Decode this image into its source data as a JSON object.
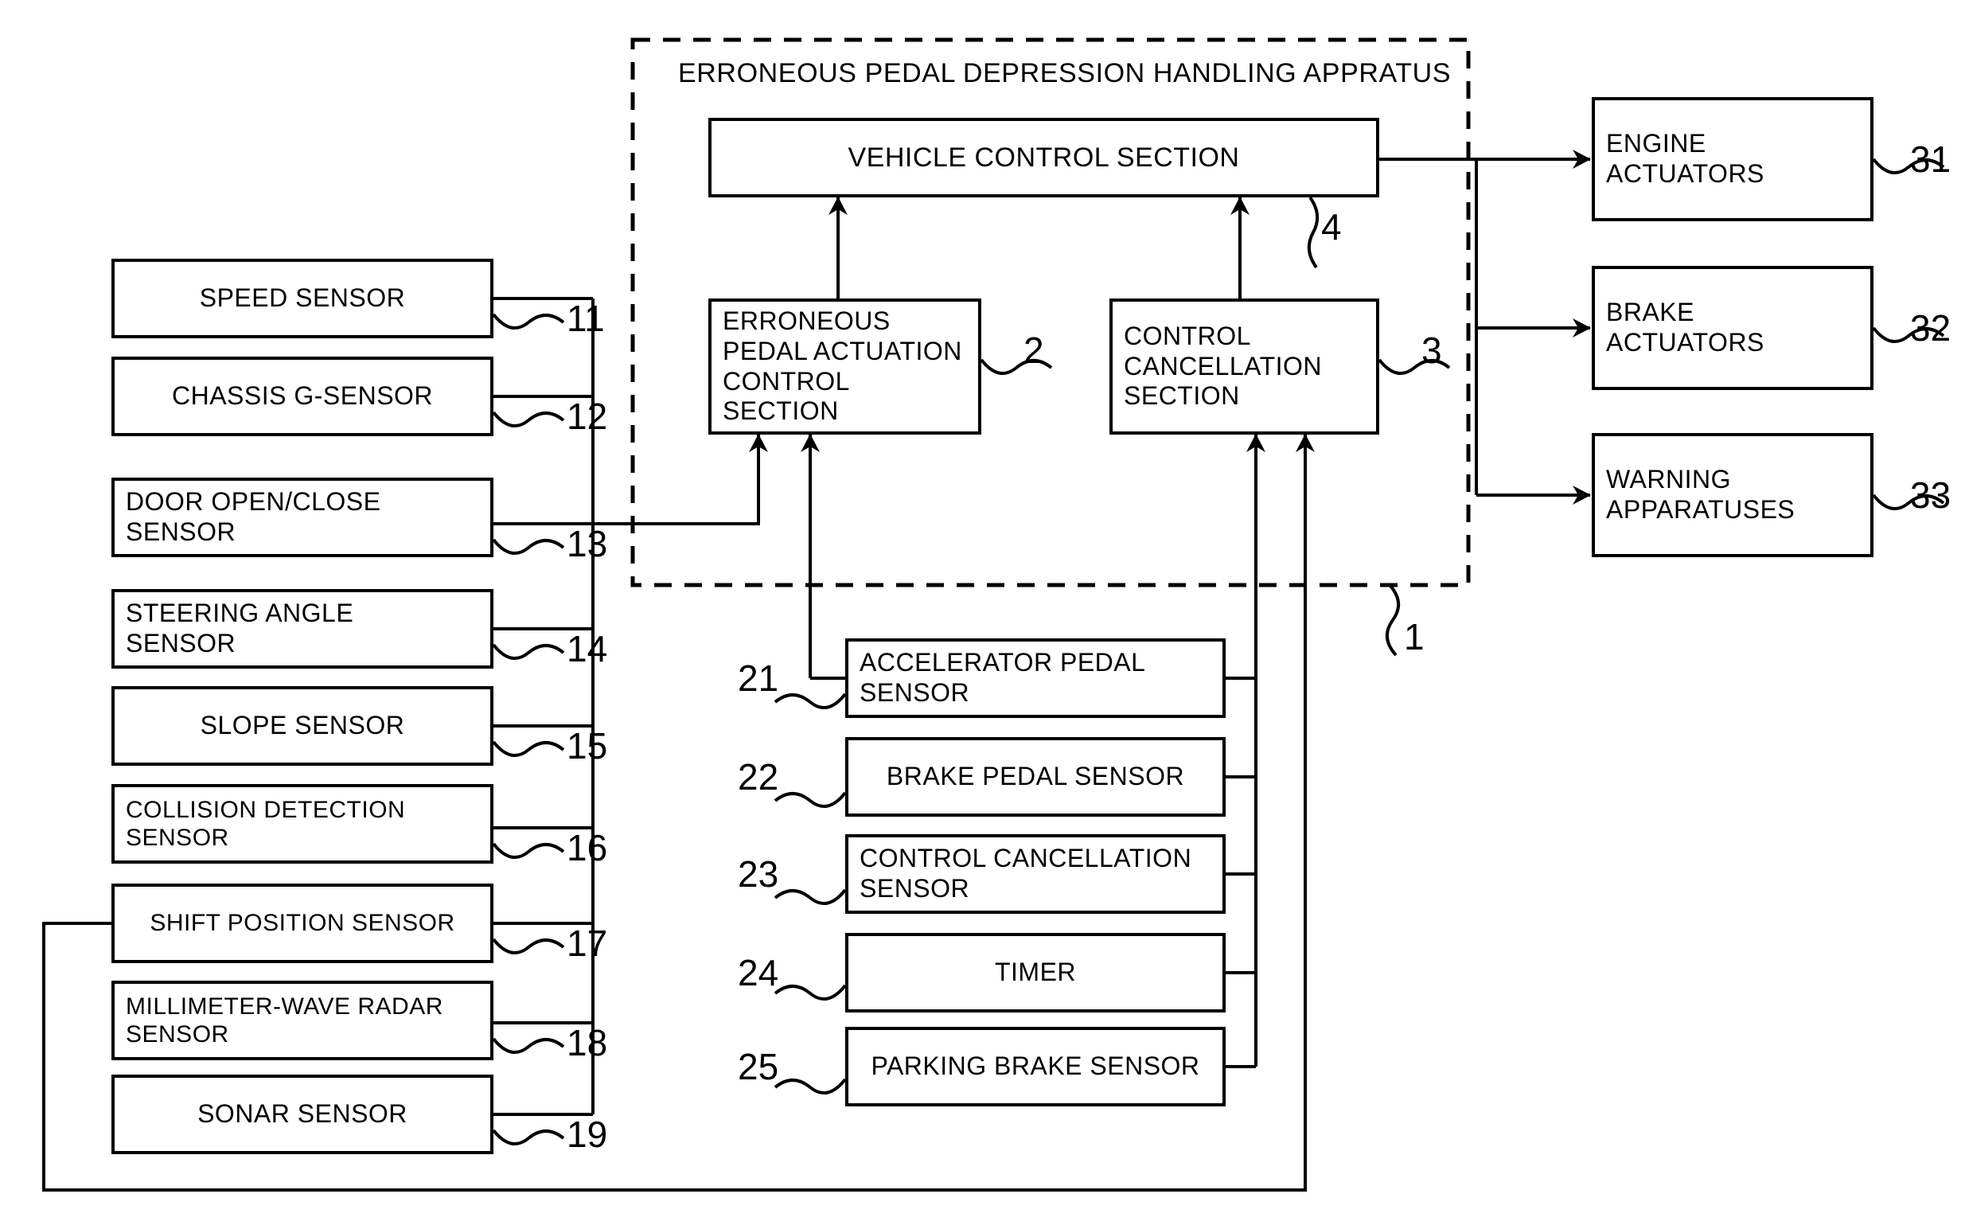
{
  "figure": {
    "enclosure_title": "ERRONEOUS PEDAL DEPRESSION HANDLING APPRATUS",
    "enclosure_ref": "1"
  },
  "apparatus": {
    "vehicle_control": {
      "label": "VEHICLE CONTROL SECTION",
      "ref": "4"
    },
    "erroneous_pedal": {
      "label": "ERRONEOUS\nPEDAL ACTUATION\nCONTROL SECTION",
      "ref": "2"
    },
    "control_cancellation": {
      "label": "CONTROL\nCANCELLATION\nSECTION",
      "ref": "3"
    }
  },
  "left_sensors": [
    {
      "label": "SPEED SENSOR",
      "ref": "11"
    },
    {
      "label": "CHASSIS G-SENSOR",
      "ref": "12"
    },
    {
      "label": "DOOR OPEN/CLOSE\nSENSOR",
      "ref": "13"
    },
    {
      "label": "STEERING ANGLE\nSENSOR",
      "ref": "14"
    },
    {
      "label": "SLOPE SENSOR",
      "ref": "15"
    },
    {
      "label": "COLLISION DETECTION\nSENSOR",
      "ref": "16"
    },
    {
      "label": "SHIFT POSITION SENSOR",
      "ref": "17"
    },
    {
      "label": "MILLIMETER-WAVE RADAR\nSENSOR",
      "ref": "18"
    },
    {
      "label": "SONAR SENSOR",
      "ref": "19"
    }
  ],
  "center_sensors": [
    {
      "label": "ACCELERATOR PEDAL\nSENSOR",
      "ref": "21"
    },
    {
      "label": "BRAKE PEDAL SENSOR",
      "ref": "22"
    },
    {
      "label": "CONTROL CANCELLATION\nSENSOR",
      "ref": "23"
    },
    {
      "label": "TIMER",
      "ref": "24"
    },
    {
      "label": "PARKING BRAKE SENSOR",
      "ref": "25"
    }
  ],
  "outputs": [
    {
      "label": "ENGINE\nACTUATORS",
      "ref": "31"
    },
    {
      "label": "BRAKE\nACTUATORS",
      "ref": "32"
    },
    {
      "label": "WARNING\nAPPARATUSES",
      "ref": "33"
    }
  ],
  "colors": {
    "line": "#000000",
    "background": "#ffffff"
  }
}
